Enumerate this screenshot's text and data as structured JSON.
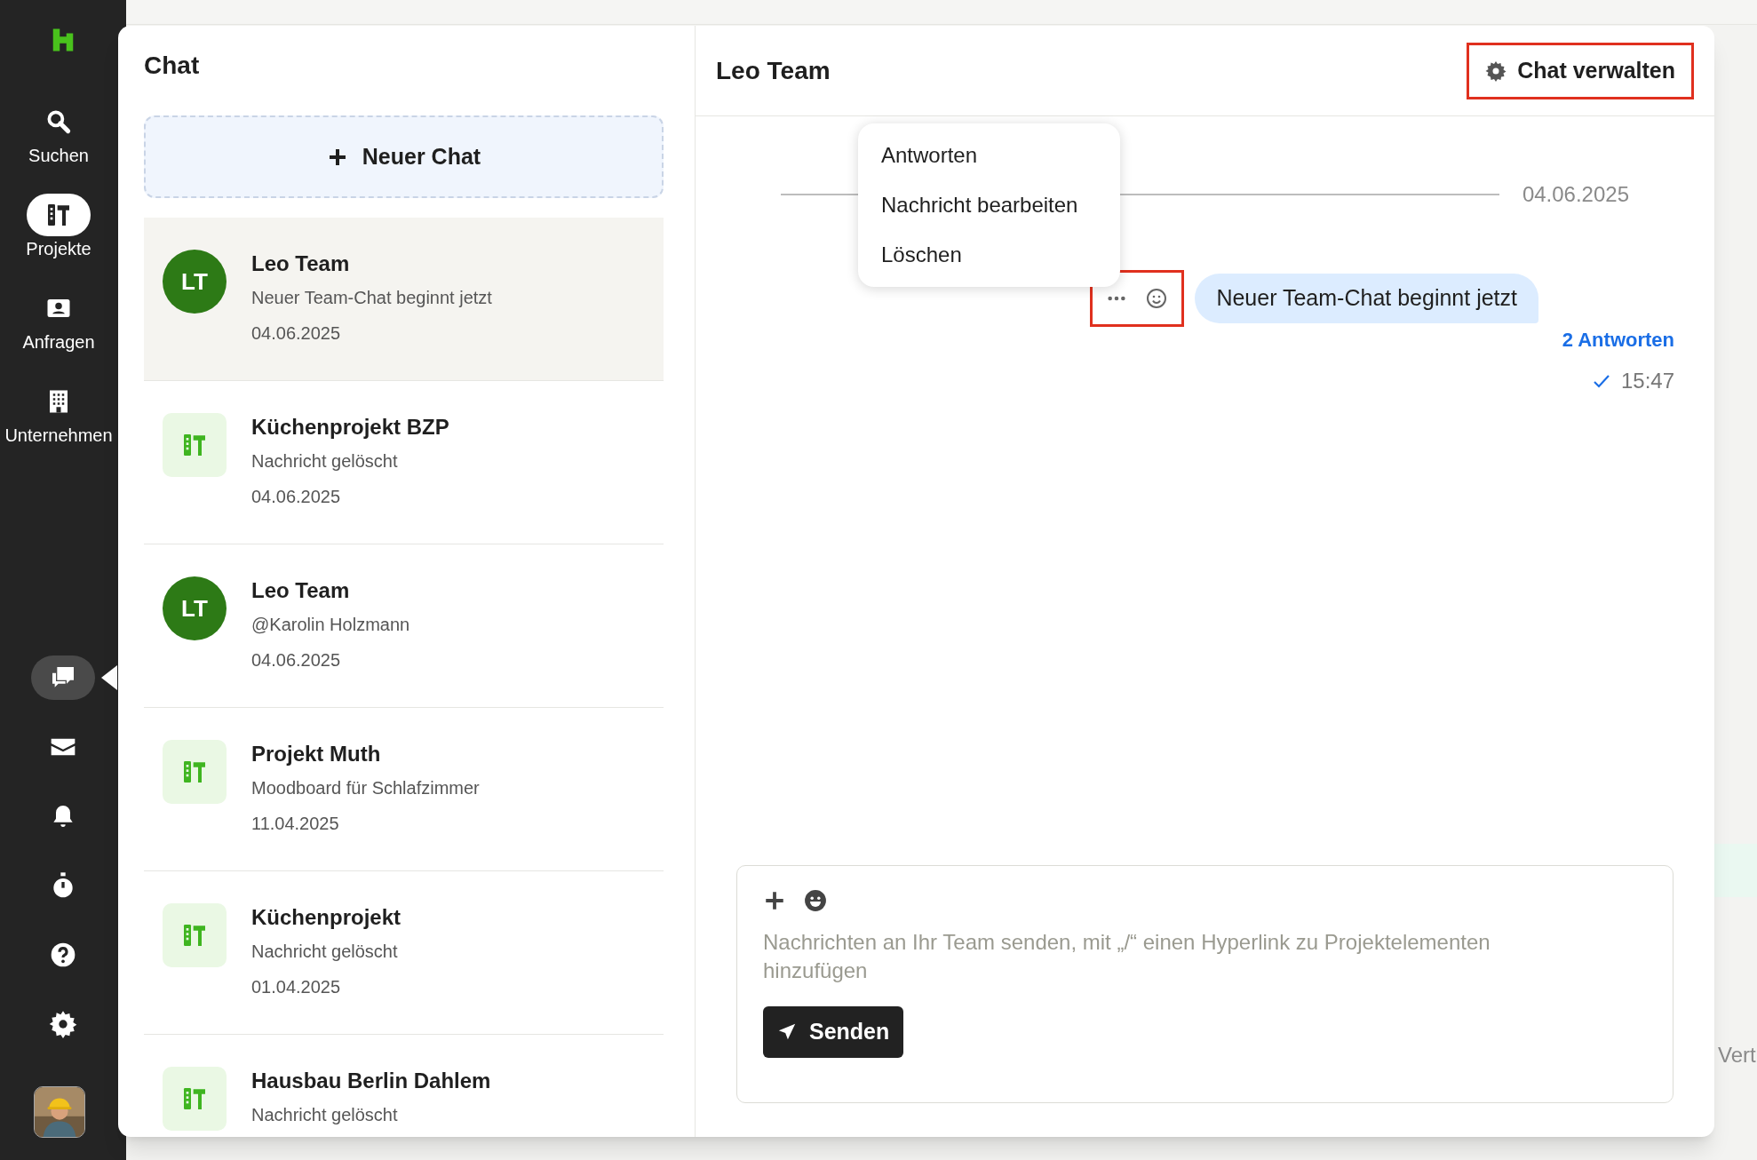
{
  "sidebar": {
    "nav": [
      {
        "kind": "search",
        "label": "Suchen",
        "selected": false
      },
      {
        "kind": "projects",
        "label": "Projekte",
        "selected": true
      },
      {
        "kind": "requests",
        "label": "Anfragen",
        "selected": false
      },
      {
        "kind": "company",
        "label": "Unternehmen",
        "selected": false
      }
    ],
    "tools": [
      {
        "kind": "chat",
        "selected": true
      },
      {
        "kind": "mail",
        "selected": false
      },
      {
        "kind": "bell",
        "selected": false
      },
      {
        "kind": "timer",
        "selected": false
      },
      {
        "kind": "help",
        "selected": false
      },
      {
        "kind": "settings",
        "selected": false
      }
    ]
  },
  "chat_list": {
    "title": "Chat",
    "new_button": "Neuer Chat",
    "items": [
      {
        "kind": "team",
        "initials": "LT",
        "name": "Leo Team",
        "preview": "Neuer Team-Chat beginnt jetzt",
        "date": "04.06.2025",
        "selected": true
      },
      {
        "kind": "project",
        "name": "Küchenprojekt BZP",
        "preview": "Nachricht gelöscht",
        "date": "04.06.2025",
        "selected": false
      },
      {
        "kind": "team",
        "initials": "LT",
        "name": "Leo Team",
        "preview": "@Karolin Holzmann",
        "date": "04.06.2025",
        "selected": false
      },
      {
        "kind": "project",
        "name": "Projekt Muth",
        "preview": "Moodboard für Schlafzimmer",
        "date": "11.04.2025",
        "selected": false
      },
      {
        "kind": "project",
        "name": "Küchenprojekt",
        "preview": "Nachricht gelöscht",
        "date": "01.04.2025",
        "selected": false
      },
      {
        "kind": "project",
        "name": "Hausbau Berlin Dahlem",
        "preview": "Nachricht gelöscht",
        "selected": false
      }
    ]
  },
  "conversation": {
    "title": "Leo Team",
    "manage_button": "Chat verwalten",
    "date_divider": "04.06.2025",
    "context_menu": [
      "Antworten",
      "Nachricht bearbeiten",
      "Löschen"
    ],
    "message": {
      "text": "Neuer Team-Chat beginnt jetzt",
      "replies": "2 Antworten",
      "time": "15:47"
    },
    "composer": {
      "placeholder": "Nachrichten an Ihr Team senden, mit „/“ einen Hyperlink zu Projektelementen hinzufügen",
      "send_button": "Senden"
    }
  },
  "background": {
    "partial_label": "Vert"
  }
}
